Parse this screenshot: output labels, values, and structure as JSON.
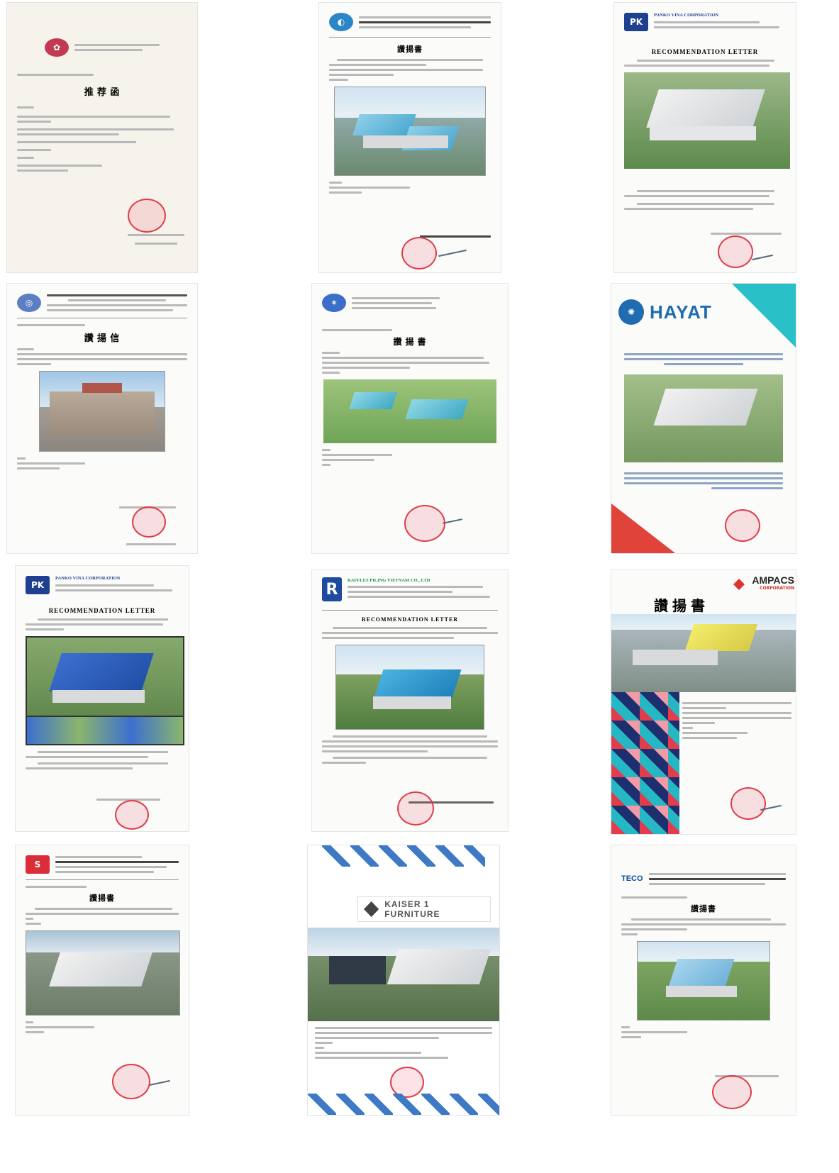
{
  "documents": [
    {
      "id": "d1",
      "company": "",
      "title": "推 荐 函"
    },
    {
      "id": "d2",
      "company": "",
      "title": "讚揚書"
    },
    {
      "id": "d3",
      "company": "PANKO VINA CORPORATION",
      "title": "RECOMMENDATION LETTER"
    },
    {
      "id": "d4",
      "company": "",
      "title": "讚 揚 信"
    },
    {
      "id": "d5",
      "company": "",
      "title": "讚 揚 書"
    },
    {
      "id": "d6",
      "company": "HAYAT",
      "title": ""
    },
    {
      "id": "d7",
      "company": "PANKO VINA CORPORATION",
      "title": "RECOMMENDATION LETTER"
    },
    {
      "id": "d8",
      "company": "RAFFLES PILING VIETNAM CO., LTD",
      "title": "RECOMMENDATION LETTER"
    },
    {
      "id": "d9",
      "company": "AMPACS",
      "company_sub": "CORPORATION",
      "title": "讚揚書"
    },
    {
      "id": "d10",
      "company": "",
      "title": "讚揚書"
    },
    {
      "id": "d11",
      "company": "KAISER 1 FURNITURE",
      "title": ""
    },
    {
      "id": "d12",
      "company": "TECO",
      "title": "讚揚書"
    }
  ],
  "colors": {
    "stamp": "#e03c4a",
    "roof_blue": "#2f6fae",
    "hayat_blue": "#1f6cb0",
    "ampacs_red": "#c33"
  }
}
